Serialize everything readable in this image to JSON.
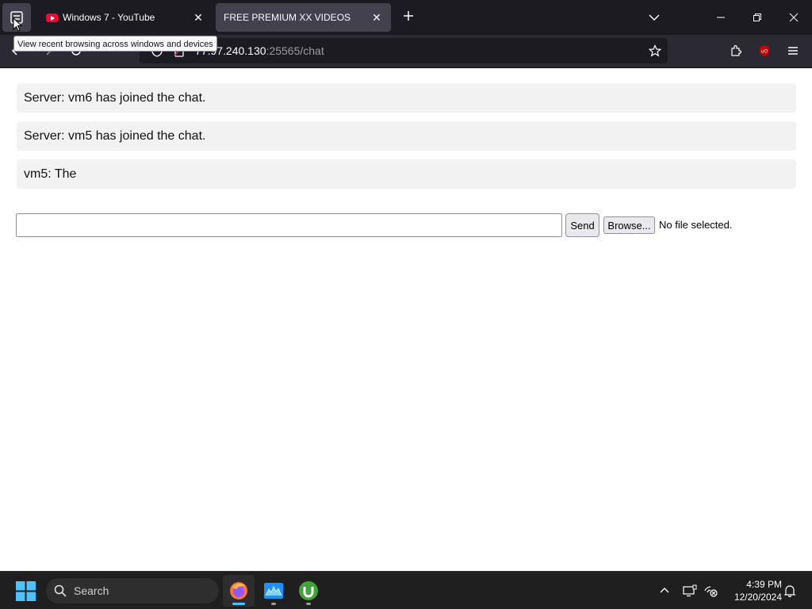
{
  "browser": {
    "tabs": [
      {
        "title": "Windows 7 - YouTube",
        "active": false
      },
      {
        "title": "FREE PREMIUM XX VIDEOS",
        "active": true
      }
    ],
    "url_host": "77.97.240.130",
    "url_path": ":25565/chat",
    "tooltip": "View recent browsing across windows and devices"
  },
  "chat": {
    "messages": [
      "Server: vm6 has joined the chat.",
      "Server: vm5 has joined the chat.",
      "vm5: The"
    ],
    "input_value": "",
    "send_label": "Send",
    "browse_label": "Browse...",
    "file_status": "No file selected."
  },
  "taskbar": {
    "search_label": "Search",
    "time": "4:39 PM",
    "date": "12/20/2024"
  },
  "colors": {
    "tabbar": "#1c1b22",
    "navbar": "#2b2a33",
    "message_bg": "#f2f2f2",
    "taskbar": "#1f1f1f",
    "ublock_red": "#c80000"
  },
  "icons": [
    "tab-list-icon",
    "youtube-icon",
    "close-icon",
    "plus-icon",
    "chevron-down-icon",
    "minimize-icon",
    "restore-icon",
    "close-window-icon",
    "back-icon",
    "forward-icon",
    "reload-icon",
    "shield-icon",
    "lock-icon",
    "star-icon",
    "extensions-icon",
    "ublock-icon",
    "menu-icon",
    "windows-start-icon",
    "search-icon",
    "firefox-icon",
    "app-icon",
    "utorrent-icon",
    "chevron-up-icon",
    "display-icon",
    "network-icon",
    "bell-icon"
  ]
}
